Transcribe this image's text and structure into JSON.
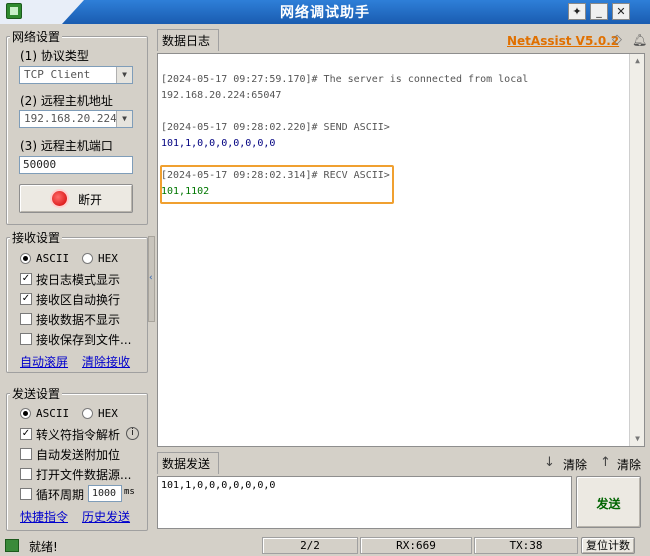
{
  "app": {
    "title": "网络调试助手",
    "brand": "NetAssist V5.0.2"
  },
  "network": {
    "group_title": "网络设置",
    "protocol_label": "(1) 协议类型",
    "protocol_value": "TCP Client",
    "host_label": "(2) 远程主机地址",
    "host_value": "192.168.20.224",
    "port_label": "(3) 远程主机端口",
    "port_value": "50000",
    "disconnect_label": "断开"
  },
  "receive": {
    "group_title": "接收设置",
    "ascii_label": "ASCII",
    "hex_label": "HEX",
    "selected_mode": "ASCII",
    "options": [
      {
        "label": "按日志模式显示",
        "checked": true
      },
      {
        "label": "接收区自动换行",
        "checked": true
      },
      {
        "label": "接收数据不显示",
        "checked": false
      },
      {
        "label": "接收保存到文件...",
        "checked": false
      }
    ],
    "auto_scroll_link": "自动滚屏",
    "clear_receive_link": "清除接收"
  },
  "send": {
    "group_title": "发送设置",
    "ascii_label": "ASCII",
    "hex_label": "HEX",
    "selected_mode": "ASCII",
    "options": [
      {
        "label": "转义符指令解析",
        "checked": true
      },
      {
        "label": "自动发送附加位",
        "checked": false
      },
      {
        "label": "打开文件数据源...",
        "checked": false
      }
    ],
    "loop_label": "循环周期",
    "loop_value": "1000",
    "loop_unit": "ms",
    "shortcut_link": "快捷指令",
    "history_link": "历史发送"
  },
  "log": {
    "tab_label": "数据日志",
    "lines": [
      {
        "text": "[2024-05-17 09:27:59.170]# The server is connected from local",
        "color": "#555555"
      },
      {
        "text": "192.168.20.224:65047",
        "color": "#555555"
      },
      {
        "text": "[2024-05-17 09:28:02.220]# SEND ASCII>",
        "color": "#555555"
      },
      {
        "text": "101,1,0,0,0,0,0,0,0",
        "color": "#000080"
      },
      {
        "text": "[2024-05-17 09:28:02.314]# RECV ASCII>",
        "color": "#555555"
      },
      {
        "text": "101,1102",
        "color": "#007700"
      }
    ],
    "highlight_color": "#f0a030"
  },
  "data_send": {
    "tab_label": "数据发送",
    "clear1_label": "清除",
    "clear2_label": "清除",
    "input_value": "101,1,0,0,0,0,0,0,0",
    "send_label": "发送"
  },
  "status": {
    "ready_text": "就绪!",
    "page": "2/2",
    "rx": "RX:669",
    "tx": "TX:38",
    "reset_label": "复位计数"
  },
  "colors": {
    "titlebar": "#1f6cc4",
    "brand": "#e07000",
    "link": "#0000cc"
  }
}
